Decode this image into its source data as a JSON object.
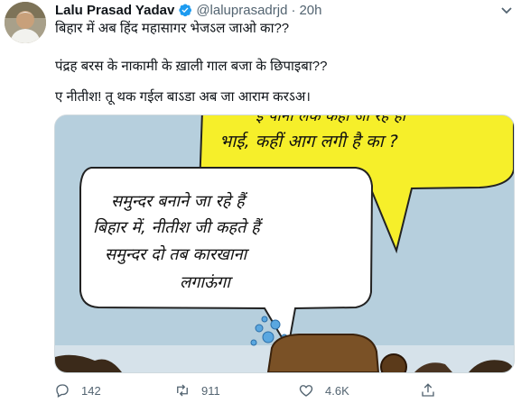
{
  "author": {
    "name": "Lalu Prasad Yadav",
    "handle": "@laluprasadrjd",
    "separator": "·",
    "time": "20h"
  },
  "tweet": {
    "lines": [
      "बिहार में अब हिंद महासागर भेजऽल जाओ का??",
      "पंद्रह बरस के नाकामी के ख़ाली गाल बजा के छिपाइबा??",
      "ए नीतीश! तू थक गईल बाऽडा अब जा आराम करऽअ।"
    ]
  },
  "cartoon": {
    "bubble_right_lines": [
      "ई पानी लेके कहां जा रहे हो",
      "भाई, कहीं आग लगी है का ?"
    ],
    "bubble_left_lines": [
      "समुन्दर बनाने जा रहे हैं",
      "बिहार में, नीतीश जी कहते हैं",
      "समुन्दर दो तब कारखाना",
      "लगाऊंगा"
    ]
  },
  "actions": {
    "reply_count": "142",
    "retweet_count": "911",
    "like_count": "4.6K"
  },
  "colors": {
    "verified": "#1d9bf0",
    "muted": "#536471",
    "bubble_yellow": "#f6ef2a",
    "sky": "#b6cfdd"
  }
}
